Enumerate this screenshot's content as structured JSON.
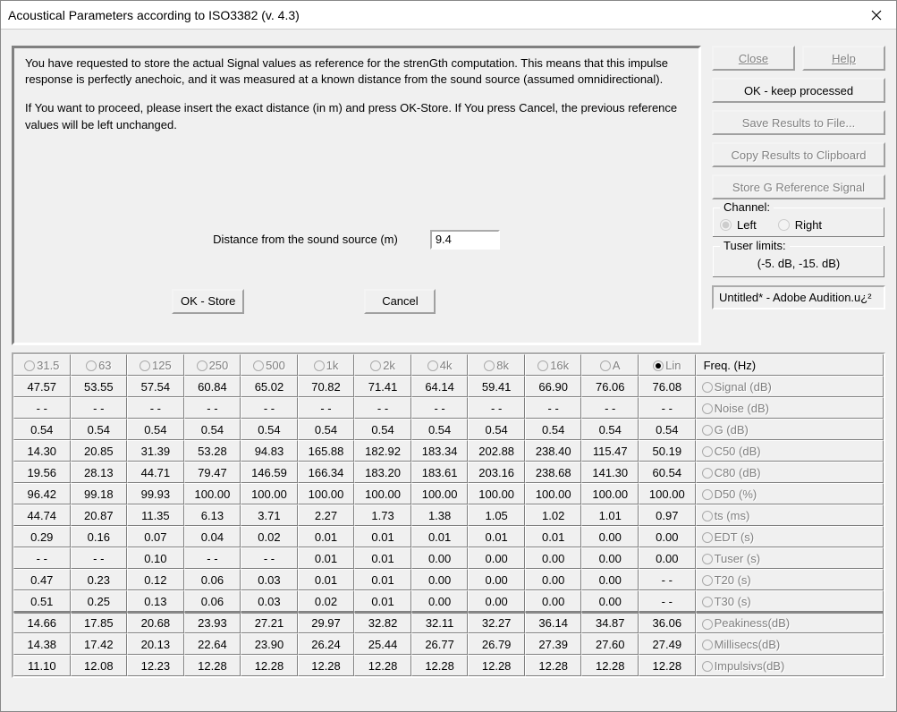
{
  "window": {
    "title": "Acoustical Parameters according to ISO3382 (v. 4.3)"
  },
  "infoPanel": {
    "p1": "You have requested to store the actual Signal values as reference for the strenGth computation. This means that this impulse response is perfectly anechoic, and it was measured at a known distance from the sound source (assumed omnidirectional).",
    "p2": "If You want to proceed, please insert the exact distance (in m) and press OK-Store. If You press Cancel, the previous reference values will be left unchanged.",
    "distanceLabel": "Distance from the sound source (m)",
    "distanceValue": "9.4",
    "okStore": "OK - Store",
    "cancel": "Cancel"
  },
  "side": {
    "close": "Close",
    "help": "Help",
    "okKeep": "OK - keep processed",
    "saveFile": "Save Results to File...",
    "copyClip": "Copy Results to Clipboard",
    "storeG": "Store G Reference Signal",
    "channelLegend": "Channel:",
    "left": "Left",
    "right": "Right",
    "tuserLegend": "Tuser  limits:",
    "tuserValue": "(-5. dB, -15. dB)",
    "status": "Untitled* - Adobe Audition.u¿²"
  },
  "freqHeader": "Freq. (Hz)",
  "freqBands": [
    "31.5",
    "63",
    "125",
    "250",
    "500",
    "1k",
    "2k",
    "4k",
    "8k",
    "16k",
    "A",
    "Lin"
  ],
  "rows": [
    {
      "label": "Signal (dB)",
      "vals": [
        "47.57",
        "53.55",
        "57.54",
        "60.84",
        "65.02",
        "70.82",
        "71.41",
        "64.14",
        "59.41",
        "66.90",
        "76.06",
        "76.08"
      ]
    },
    {
      "label": "Noise (dB)",
      "vals": [
        "- -",
        "- -",
        "- -",
        "- -",
        "- -",
        "- -",
        "- -",
        "- -",
        "- -",
        "- -",
        "- -",
        "- -"
      ]
    },
    {
      "label": "G (dB)",
      "vals": [
        "0.54",
        "0.54",
        "0.54",
        "0.54",
        "0.54",
        "0.54",
        "0.54",
        "0.54",
        "0.54",
        "0.54",
        "0.54",
        "0.54"
      ]
    },
    {
      "label": "C50 (dB)",
      "vals": [
        "14.30",
        "20.85",
        "31.39",
        "53.28",
        "94.83",
        "165.88",
        "182.92",
        "183.34",
        "202.88",
        "238.40",
        "115.47",
        "50.19"
      ]
    },
    {
      "label": "C80 (dB)",
      "vals": [
        "19.56",
        "28.13",
        "44.71",
        "79.47",
        "146.59",
        "166.34",
        "183.20",
        "183.61",
        "203.16",
        "238.68",
        "141.30",
        "60.54"
      ]
    },
    {
      "label": "D50 (%)",
      "vals": [
        "96.42",
        "99.18",
        "99.93",
        "100.00",
        "100.00",
        "100.00",
        "100.00",
        "100.00",
        "100.00",
        "100.00",
        "100.00",
        "100.00"
      ]
    },
    {
      "label": "ts (ms)",
      "vals": [
        "44.74",
        "20.87",
        "11.35",
        "6.13",
        "3.71",
        "2.27",
        "1.73",
        "1.38",
        "1.05",
        "1.02",
        "1.01",
        "0.97"
      ]
    },
    {
      "label": "EDT (s)",
      "vals": [
        "0.29",
        "0.16",
        "0.07",
        "0.04",
        "0.02",
        "0.01",
        "0.01",
        "0.01",
        "0.01",
        "0.01",
        "0.00",
        "0.00"
      ]
    },
    {
      "label": "Tuser (s)",
      "vals": [
        "- -",
        "- -",
        "0.10",
        "- -",
        "- -",
        "0.01",
        "0.01",
        "0.00",
        "0.00",
        "0.00",
        "0.00",
        "0.00"
      ]
    },
    {
      "label": "T20 (s)",
      "vals": [
        "0.47",
        "0.23",
        "0.12",
        "0.06",
        "0.03",
        "0.01",
        "0.01",
        "0.00",
        "0.00",
        "0.00",
        "0.00",
        "- -"
      ]
    },
    {
      "label": "T30 (s)",
      "vals": [
        "0.51",
        "0.25",
        "0.13",
        "0.06",
        "0.03",
        "0.02",
        "0.01",
        "0.00",
        "0.00",
        "0.00",
        "0.00",
        "- -"
      ]
    }
  ],
  "rows2": [
    {
      "label": "Peakiness(dB)",
      "vals": [
        "14.66",
        "17.85",
        "20.68",
        "23.93",
        "27.21",
        "29.97",
        "32.82",
        "32.11",
        "32.27",
        "36.14",
        "34.87",
        "36.06"
      ]
    },
    {
      "label": "Millisecs(dB)",
      "vals": [
        "14.38",
        "17.42",
        "20.13",
        "22.64",
        "23.90",
        "26.24",
        "25.44",
        "26.77",
        "26.79",
        "27.39",
        "27.60",
        "27.49"
      ]
    },
    {
      "label": "Impulsivs(dB)",
      "vals": [
        "11.10",
        "12.08",
        "12.23",
        "12.28",
        "12.28",
        "12.28",
        "12.28",
        "12.28",
        "12.28",
        "12.28",
        "12.28",
        "12.28"
      ]
    }
  ]
}
